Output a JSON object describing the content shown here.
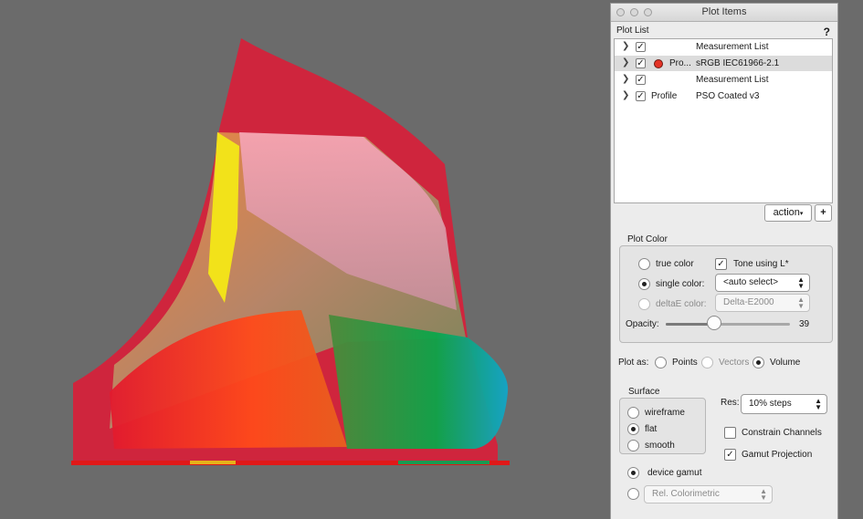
{
  "window": {
    "title": "Plot Items"
  },
  "plot_list": {
    "label": "Plot List",
    "help": "?",
    "rows": [
      {
        "col1": "",
        "name": "Measurement List",
        "checked": true
      },
      {
        "col1": "Pro...",
        "name": "sRGB IEC61966-2.1",
        "checked": true,
        "color": "#e53326"
      },
      {
        "col1": "",
        "name": "Measurement List",
        "checked": true
      },
      {
        "col1": "Profile",
        "name": "PSO Coated v3",
        "checked": true
      }
    ],
    "action_button": "action",
    "add_button": "+"
  },
  "plot_color": {
    "label": "Plot Color",
    "true_color": "true color",
    "tone_using": "Tone using L*",
    "single_color": "single color:",
    "single_color_value": "<auto select>",
    "deltae_color": "deltaE color:",
    "deltae_value": "Delta-E2000",
    "opacity_label": "Opacity:",
    "opacity_value": "39",
    "opacity_fraction": 0.39
  },
  "plot_as": {
    "label": "Plot as:",
    "options": [
      "Points",
      "Vectors",
      "Volume"
    ],
    "selected": "Volume"
  },
  "surface": {
    "label": "Surface",
    "options": [
      "wireframe",
      "flat",
      "smooth"
    ],
    "selected": "flat"
  },
  "resolution": {
    "label": "Res:",
    "value": "10% steps"
  },
  "constrain_channels": {
    "label": "Constrain Channels",
    "checked": false
  },
  "gamut_projection": {
    "label": "Gamut Projection",
    "checked": true
  },
  "gamut": {
    "device_gamut": "device gamut",
    "intent_value": "Rel. Colorimetric"
  }
}
